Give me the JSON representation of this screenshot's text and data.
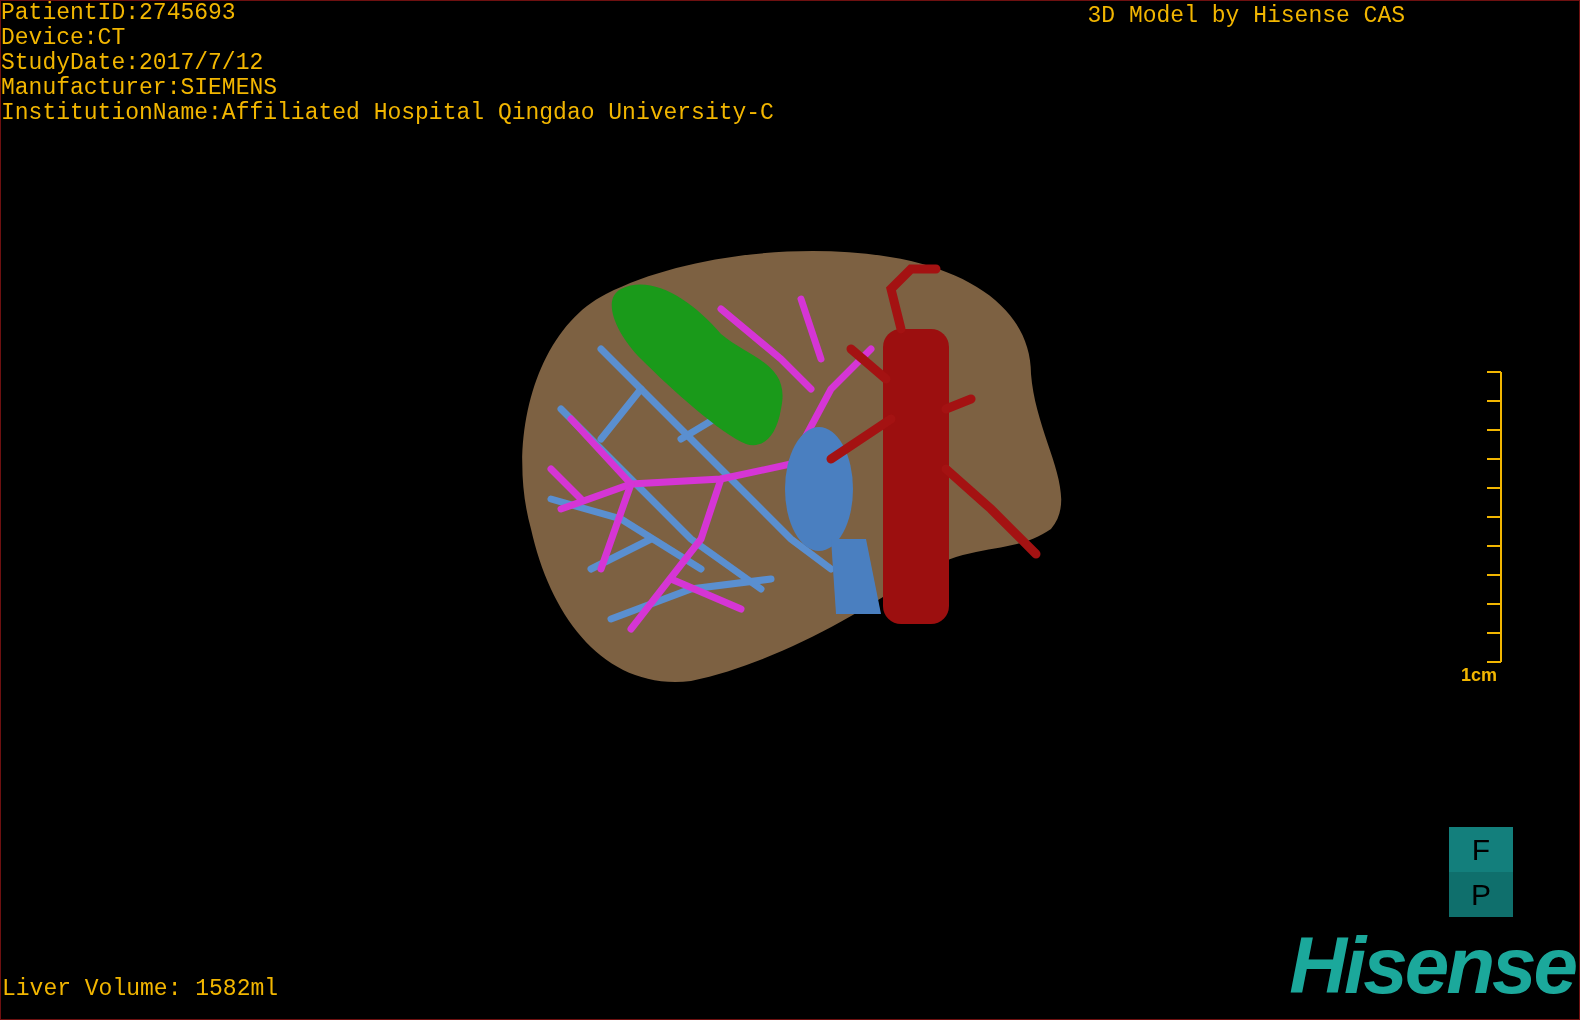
{
  "patient_info": [
    "PatientID:2745693",
    "Device:CT",
    "StudyDate:2017/7/12",
    "Manufacturer:SIEMENS",
    "InstitutionName:Affiliated Hospital Qingdao University-C"
  ],
  "title": "3D Model by Hisense CAS",
  "scale_bar": {
    "label": "1cm"
  },
  "orientation": {
    "top": "F",
    "bottom": "P"
  },
  "liver_volume": "Liver Volume: 1582ml",
  "logo": "Hisense"
}
